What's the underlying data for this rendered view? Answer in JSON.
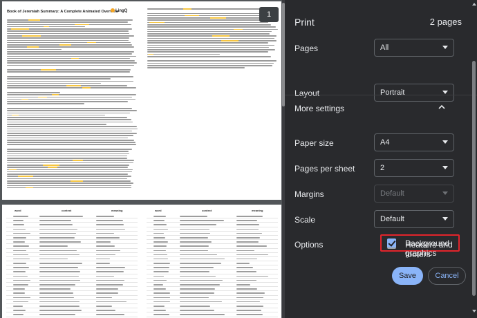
{
  "preview": {
    "page_badge": "1",
    "page1": {
      "title": "Book of Jeremiah Summary: A Complete Animated Overview",
      "logo": "LingQ"
    },
    "page2": {
      "col_word": "word",
      "col_context": "context",
      "col_meaning": "meaning"
    }
  },
  "dialog": {
    "title": "Print",
    "sheet_count": "2 pages",
    "settings": [
      {
        "label": "Pages",
        "value": "All",
        "disabled": false
      },
      {
        "label": "Layout",
        "value": "Portrait",
        "disabled": false
      }
    ],
    "more_settings": "More settings",
    "more": [
      {
        "label": "Paper size",
        "value": "A4",
        "disabled": false
      },
      {
        "label": "Pages per sheet",
        "value": "2",
        "disabled": false
      },
      {
        "label": "Margins",
        "value": "Default",
        "disabled": true
      },
      {
        "label": "Scale",
        "value": "Default",
        "disabled": false
      }
    ],
    "options_label": "Options",
    "options": [
      {
        "label": "Headers and footers",
        "checked": false
      },
      {
        "label": "Background graphics",
        "checked": true
      }
    ],
    "save_label": "Save",
    "cancel_label": "Cancel"
  }
}
